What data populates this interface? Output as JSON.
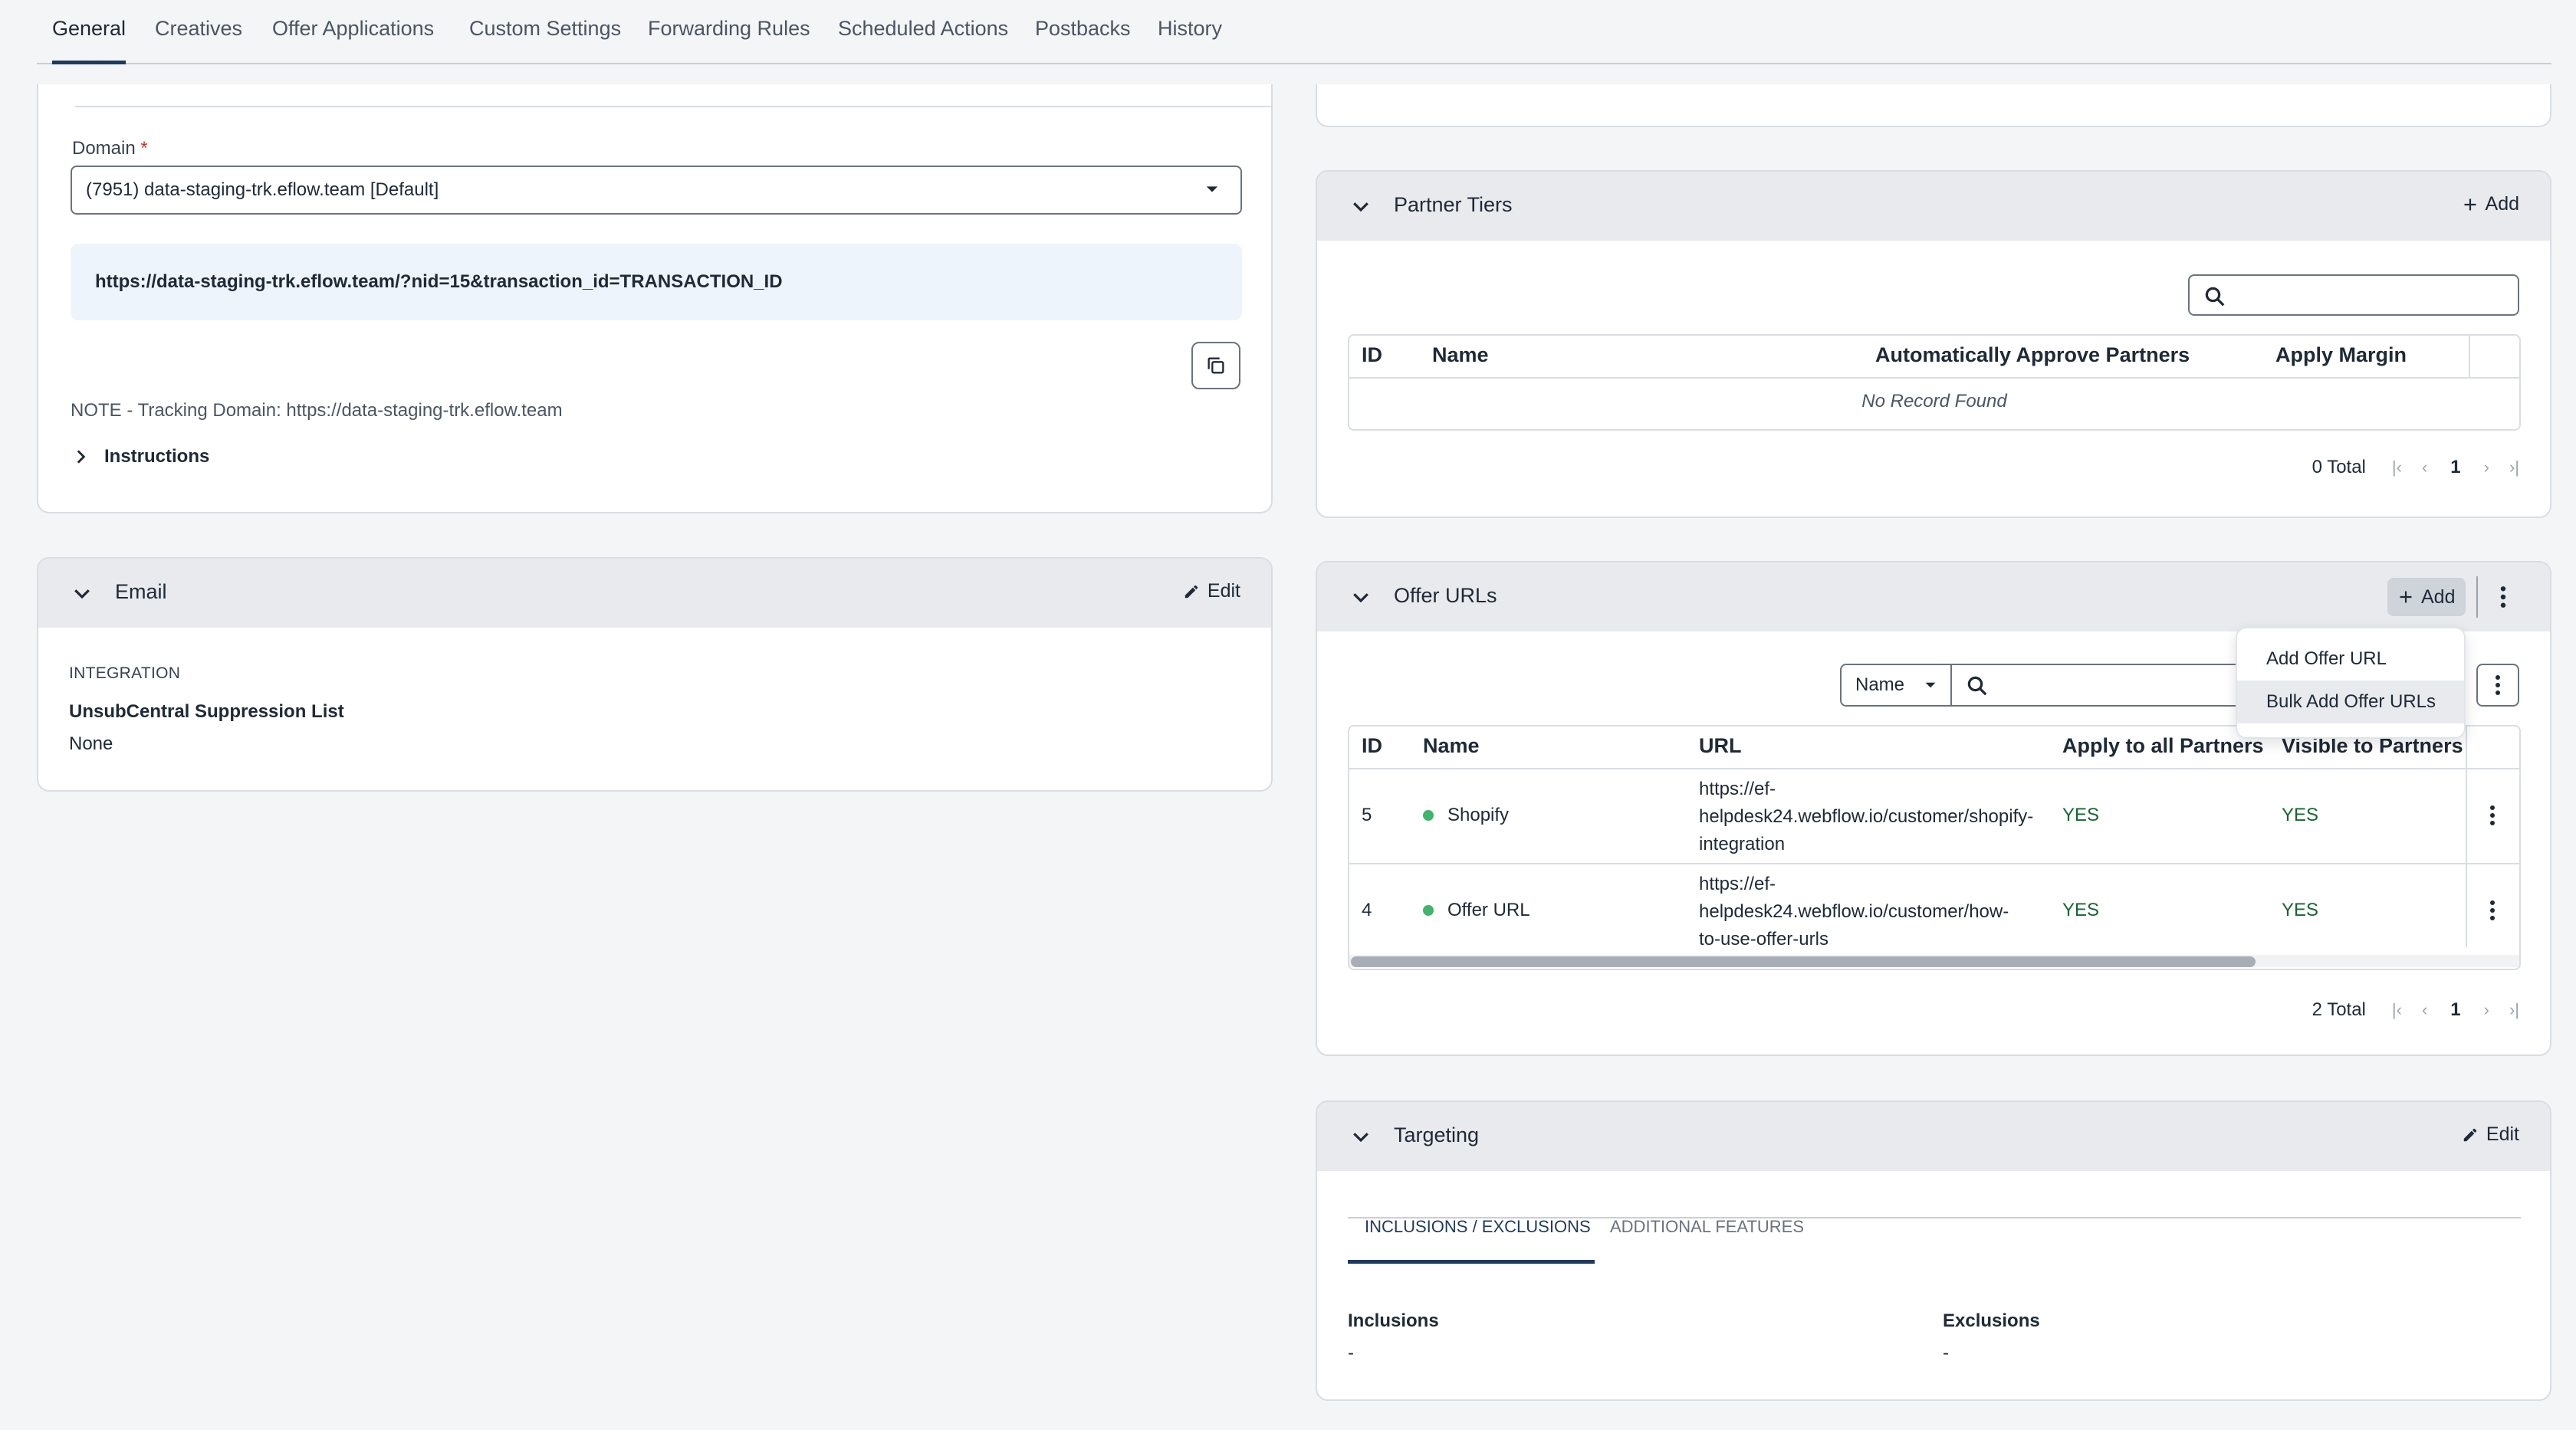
{
  "tabs": [
    {
      "label": "General",
      "active": true
    },
    {
      "label": "Creatives"
    },
    {
      "label": "Offer Applications"
    },
    {
      "label": "Custom Settings"
    },
    {
      "label": "Forwarding Rules"
    },
    {
      "label": "Scheduled Actions"
    },
    {
      "label": "Postbacks"
    },
    {
      "label": "History"
    }
  ],
  "tracking": {
    "domain_label": "Domain",
    "required_mark": "*",
    "domain_value": "(7951) data-staging-trk.eflow.team [Default]",
    "tracking_url": "https://data-staging-trk.eflow.team/?nid=15&transaction_id=TRANSACTION_ID",
    "note": "NOTE - Tracking Domain: https://data-staging-trk.eflow.team",
    "instructions_label": "Instructions"
  },
  "email": {
    "title": "Email",
    "edit_label": "Edit",
    "section_label": "INTEGRATION",
    "field_label": "UnsubCentral Suppression List",
    "field_value": "None"
  },
  "partner_tiers": {
    "title": "Partner Tiers",
    "add_label": "Add",
    "columns": [
      "ID",
      "Name",
      "Automatically Approve Partners",
      "Apply Margin"
    ],
    "empty_text": "No Record Found",
    "total": "0 Total",
    "page": "1"
  },
  "offer_urls": {
    "title": "Offer URLs",
    "add_label": "Add",
    "filter_select": "Name",
    "columns": [
      "ID",
      "Name",
      "URL",
      "Apply to all Partners",
      "Visible to Partners"
    ],
    "rows": [
      {
        "id": "5",
        "name": "Shopify",
        "url_lines": [
          "https://ef-",
          "helpdesk24.webflow.io/customer/shopify-",
          "integration"
        ],
        "apply_all": "YES",
        "visible": "YES"
      },
      {
        "id": "4",
        "name": "Offer URL",
        "url_lines": [
          "https://ef-",
          "helpdesk24.webflow.io/customer/how-",
          "to-use-offer-urls"
        ],
        "apply_all": "YES",
        "visible": "YES"
      }
    ],
    "total": "2 Total",
    "page": "1",
    "menu": [
      "Add Offer URL",
      "Bulk Add Offer URLs"
    ]
  },
  "targeting": {
    "title": "Targeting",
    "edit_label": "Edit",
    "subtabs": [
      "INCLUSIONS / EXCLUSIONS",
      "ADDITIONAL FEATURES"
    ],
    "inclusions_label": "Inclusions",
    "inclusions_value": "-",
    "exclusions_label": "Exclusions",
    "exclusions_value": "-"
  },
  "colors": {
    "accent": "#1e3a5f",
    "yes": "#166534",
    "status_dot": "#3fb56a",
    "header_bg": "#e8eaee"
  }
}
